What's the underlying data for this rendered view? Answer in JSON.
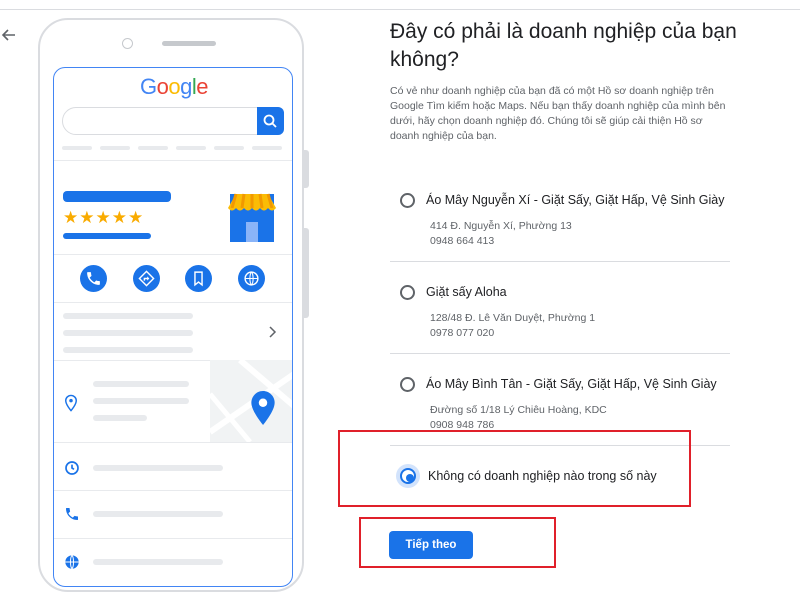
{
  "header": {
    "back_icon": "arrow-back-icon"
  },
  "illustration": {
    "logo": [
      {
        "ch": "G",
        "color": "#4285f4"
      },
      {
        "ch": "o",
        "color": "#ea4335"
      },
      {
        "ch": "o",
        "color": "#fbbc05"
      },
      {
        "ch": "g",
        "color": "#4285f4"
      },
      {
        "ch": "l",
        "color": "#34a853"
      },
      {
        "ch": "e",
        "color": "#ea4335"
      }
    ],
    "stars": "★★★★★",
    "action_icons": [
      "phone-icon",
      "directions-icon",
      "bookmark-icon",
      "website-icon"
    ],
    "side_icons": [
      "location-pin-icon",
      "clock-icon",
      "phone-icon",
      "globe-icon"
    ]
  },
  "main": {
    "title": "Đây có phải là doanh nghiệp của bạn không?",
    "description": "Có vẻ như doanh nghiệp của bạn đã có một Hồ sơ doanh nghiệp trên Google Tìm kiếm hoặc Maps. Nếu bạn thấy doanh nghiệp của mình bên dưới, hãy chọn doanh nghiệp đó. Chúng tôi sẽ giúp cải thiện Hồ sơ doanh nghiệp của bạn.",
    "options": [
      {
        "name": "Áo Mây Nguyễn Xí - Giặt Sấy, Giặt Hấp, Vệ Sinh Giày",
        "address": "414 Đ. Nguyễn Xí, Phường 13",
        "phone": "0948 664 413"
      },
      {
        "name": "Giặt sấy Aloha",
        "address": "128/48 Đ. Lê Văn Duyệt, Phường 1",
        "phone": "0978 077 020"
      },
      {
        "name": "Áo Mây Bình Tân - Giặt Sấy, Giặt Hấp, Vệ Sinh Giày",
        "address": "Đường số 1/18 Lý Chiêu Hoàng, KDC",
        "phone": "0908 948 786"
      }
    ],
    "none_option": "Không có doanh nghiệp nào trong số này",
    "next_button": "Tiếp theo"
  },
  "colors": {
    "accent": "#1a73e8",
    "highlight": "#e0202a",
    "star": "#f9ab00"
  }
}
